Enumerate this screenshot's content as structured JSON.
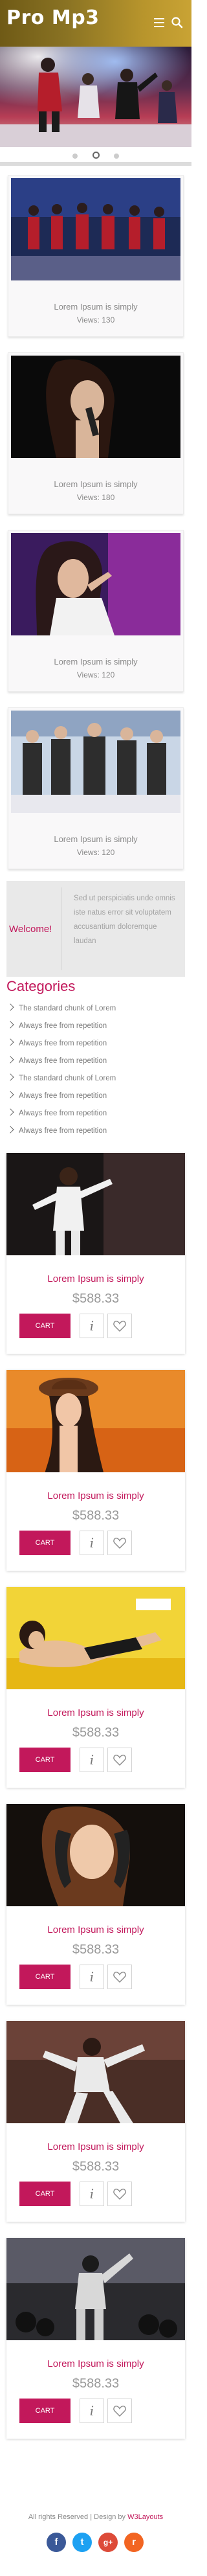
{
  "header": {
    "logo": "Pro Mp3"
  },
  "slider": {
    "dots": 3,
    "active_dot": 2
  },
  "videos": [
    {
      "title": "Lorem Ipsum is simply",
      "views_label": "Views:",
      "views": "130"
    },
    {
      "title": "Lorem Ipsum is simply",
      "views_label": "Views:",
      "views": "180"
    },
    {
      "title": "Lorem Ipsum is simply",
      "views_label": "Views:",
      "views": "120"
    },
    {
      "title": "Lorem Ipsum is simply",
      "views_label": "Views:",
      "views": "120"
    }
  ],
  "welcome": {
    "title": "Welcome!",
    "text": "Sed ut perspiciatis unde omnis iste natus error sit voluptatem accusantium doloremque laudan"
  },
  "categories": {
    "title": "Categories",
    "items": [
      "The standard chunk of Lorem",
      "Always free from repetition",
      "Always free from repetition",
      "Always free from repetition",
      "The standard chunk of Lorem",
      "Always free from repetition",
      "Always free from repetition",
      "Always free from repetition"
    ]
  },
  "products": [
    {
      "title": "Lorem Ipsum is simply",
      "price": "$588.33",
      "cart": "CART"
    },
    {
      "title": "Lorem Ipsum is simply",
      "price": "$588.33",
      "cart": "CART"
    },
    {
      "title": "Lorem Ipsum is simply",
      "price": "$588.33",
      "cart": "CART"
    },
    {
      "title": "Lorem Ipsum is simply",
      "price": "$588.33",
      "cart": "CART"
    },
    {
      "title": "Lorem Ipsum is simply",
      "price": "$588.33",
      "cart": "CART"
    },
    {
      "title": "Lorem Ipsum is simply",
      "price": "$588.33",
      "cart": "CART"
    }
  ],
  "footer": {
    "text": "All rights Reserved | Design by",
    "brand": "W3Layouts",
    "social": [
      {
        "name": "facebook",
        "glyph": "f",
        "color": "#3b5998"
      },
      {
        "name": "twitter",
        "glyph": "t",
        "color": "#1da1f2"
      },
      {
        "name": "google-plus",
        "glyph": "g+",
        "color": "#dd4b39"
      },
      {
        "name": "rss",
        "glyph": "r",
        "color": "#f26522"
      }
    ]
  },
  "colors": {
    "accent": "#c2185b",
    "header": "#a7892a"
  }
}
